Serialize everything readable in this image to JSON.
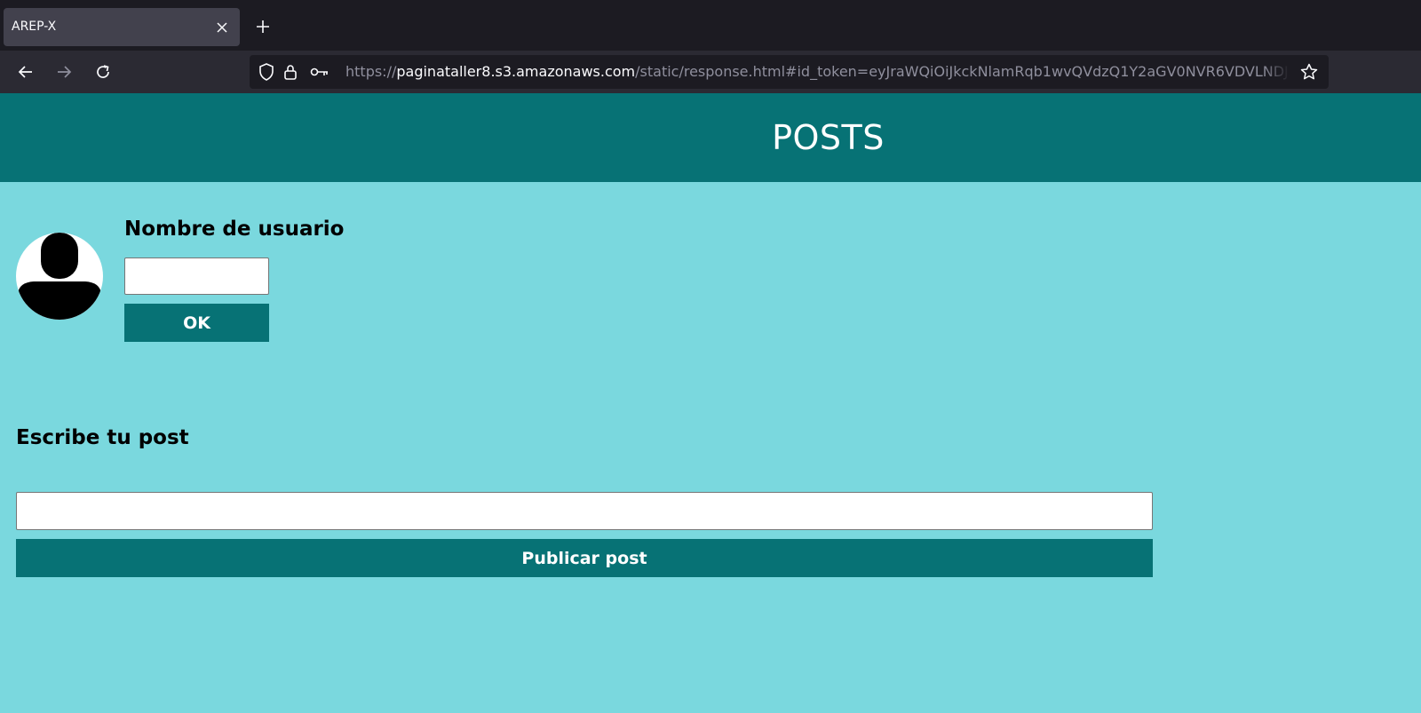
{
  "browser": {
    "tab_title": "AREP-X",
    "url_scheme": "https://",
    "url_host": "paginataller8.s3.amazonaws.com",
    "url_rest": "/static/response.html#id_token=eyJraWQiOiJkckNlamRqb1wvQVdzQ1Y2aGV0NVR6VDVLNDJxdkpIcmgxO",
    "icons": {
      "tab_close": "close-icon",
      "new_tab": "plus-icon",
      "back": "arrow-left-icon",
      "forward": "arrow-right-icon",
      "reload": "reload-icon",
      "tracking": "shield-icon",
      "lock": "lock-icon",
      "key": "key-icon",
      "bookmark": "star-icon"
    }
  },
  "page": {
    "title": "POSTS",
    "user_label": "Nombre de usuario",
    "user_input_value": "",
    "ok_label": "OK",
    "post_label": "Escribe tu post",
    "post_input_value": "",
    "publish_label": "Publicar post",
    "avatar_icon": "user-silhouette-icon"
  },
  "colors": {
    "header_bg": "#077275",
    "page_bg": "#7ad8de",
    "button_bg": "#077275",
    "button_text": "#ffffff"
  }
}
